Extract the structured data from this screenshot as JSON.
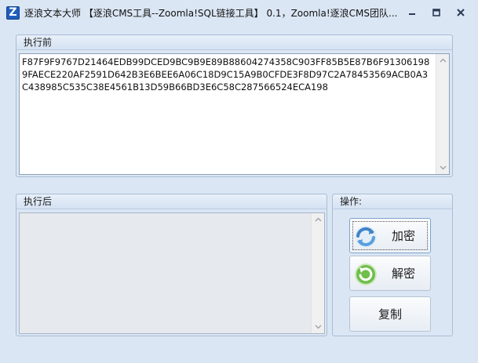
{
  "window": {
    "icon_letter": "Z",
    "title": "逐浪文本大师 【逐浪CMS工具--Zoomla!SQL链接工具】 0.1，Zoomla!逐浪CMS团队...",
    "controls": [
      "minimize-icon",
      "maximize-icon",
      "close-icon"
    ]
  },
  "before_group": {
    "label": "执行前",
    "text": "F87F9F9767D21464EDB99DCED9BC9B9E89B88604274358C903FF85B5E87B6F913061989FAECE220AF2591D642B3E6BEE6A06C18D9C15A9B0CFDE3F8D97C2A78453569ACB0A3C438985C535C38E4561B13D59B66BD3E6C58C287566524ECA198"
  },
  "after_group": {
    "label": "执行后",
    "text": ""
  },
  "operations_group": {
    "label": "操作:",
    "buttons": {
      "encrypt": {
        "label": "加密",
        "icon": "refresh-arrows-icon"
      },
      "decrypt": {
        "label": "解密",
        "icon": "green-refresh-icon"
      },
      "copy": {
        "label": "复制"
      }
    }
  }
}
